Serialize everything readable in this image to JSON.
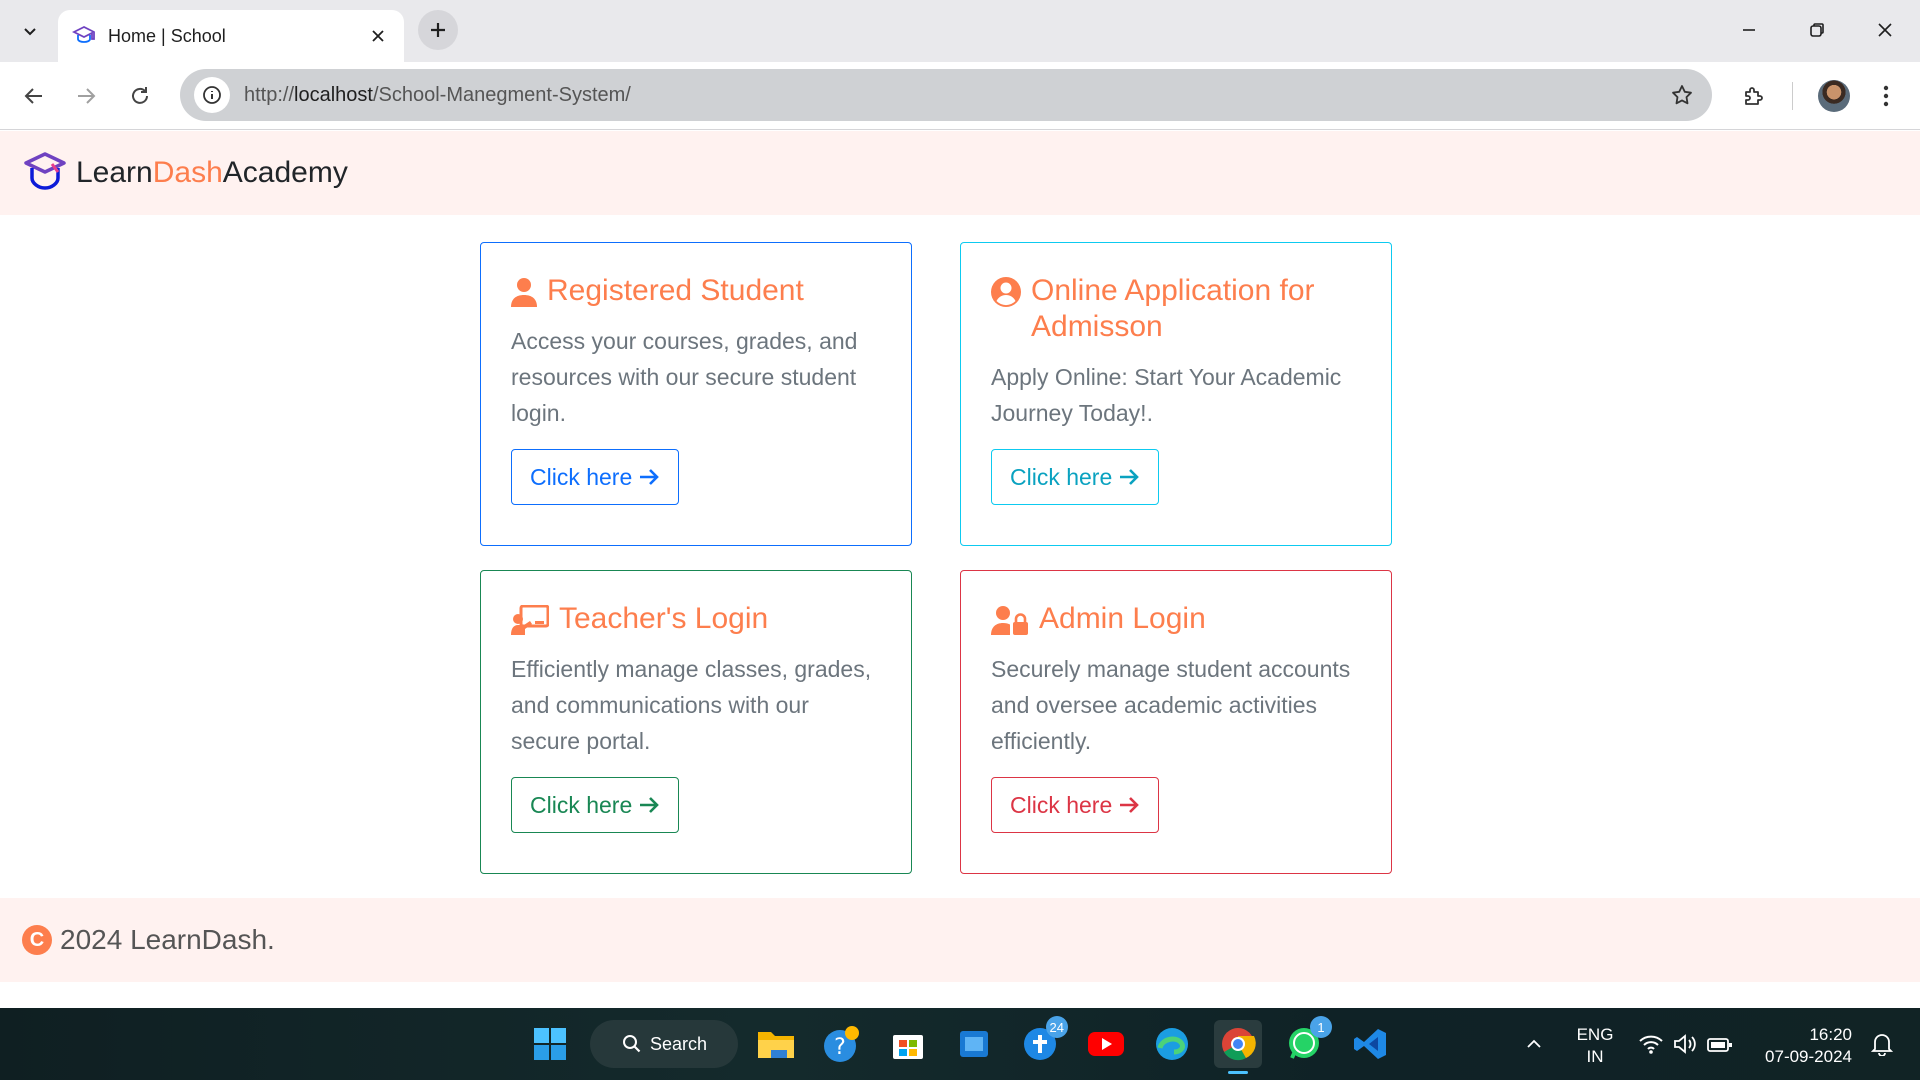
{
  "browser": {
    "tab_title": "Home | School",
    "url_prefix": "http://",
    "url_host": "localhost",
    "url_path": "/School-Manegment-System/"
  },
  "brand": {
    "part1": "Learn",
    "part2": "Dash",
    "part3": "Academy",
    "accent_color": "#fd7e4d"
  },
  "cards": [
    {
      "title": "Registered Student",
      "text": "Access your courses, grades, and resources with our secure student login.",
      "button": "Click here",
      "border_color": "#0d6efd",
      "icon": "user-icon"
    },
    {
      "title": "Online Application for Admisson",
      "text": "Apply Online: Start Your Academic Journey Today!.",
      "button": "Click here",
      "border_color": "#0dcaf0",
      "icon": "user-circle-icon"
    },
    {
      "title": "Teacher's Login",
      "text": "Efficiently manage classes, grades, and communications with our secure portal.",
      "button": "Click here",
      "border_color": "#198754",
      "icon": "chalkboard-teacher-icon"
    },
    {
      "title": "Admin Login",
      "text": "Securely manage student accounts and oversee academic activities efficiently.",
      "button": "Click here",
      "border_color": "#dc3545",
      "icon": "user-lock-icon"
    }
  ],
  "footer": {
    "text": "2024 LearnDash."
  },
  "taskbar": {
    "search_label": "Search",
    "lang_line1": "ENG",
    "lang_line2": "IN",
    "time": "16:20",
    "date": "07-09-2024",
    "badge_teams": "24",
    "badge_whatsapp": "1"
  }
}
